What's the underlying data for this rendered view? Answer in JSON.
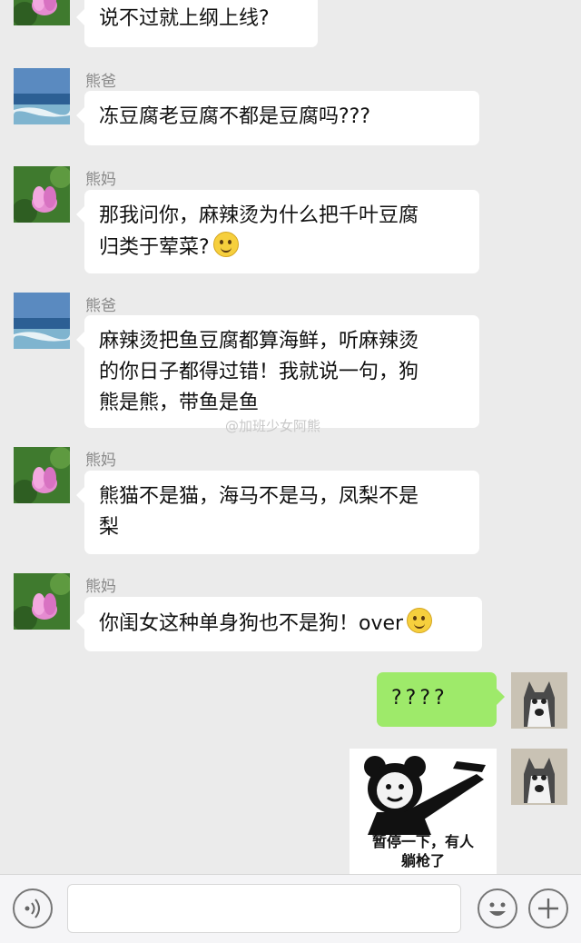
{
  "messages": [
    {
      "sender": "",
      "text": "说不过就上纲上线?"
    },
    {
      "sender": "熊爸",
      "text": "冻豆腐老豆腐不都是豆腐吗???"
    },
    {
      "sender": "熊妈",
      "text": "那我问你，麻辣烫为什么把千叶豆腐\n归类于荤菜?"
    },
    {
      "sender": "熊爸",
      "text": "麻辣烫把鱼豆腐都算海鲜，听麻辣烫\n的你日子都得过错！我就说一句，狗\n熊是熊，带鱼是鱼"
    },
    {
      "sender": "熊妈",
      "text": "熊猫不是猫，海马不是马，凤梨不是\n梨"
    },
    {
      "sender": "熊妈",
      "text": "你闺女这种单身狗也不是狗！over"
    },
    {
      "sender": "",
      "text": "????"
    }
  ],
  "watermark": "@加班少女阿熊",
  "sticker_caption": "暂停一下，有人\n躺枪了",
  "avatars": {
    "mom": "lotus-flower",
    "dad": "sea-horizon",
    "me": "husky-dog"
  },
  "colors": {
    "my_bubble": "#9eea6a",
    "their_bubble": "#ffffff",
    "background": "#ebebeb"
  }
}
